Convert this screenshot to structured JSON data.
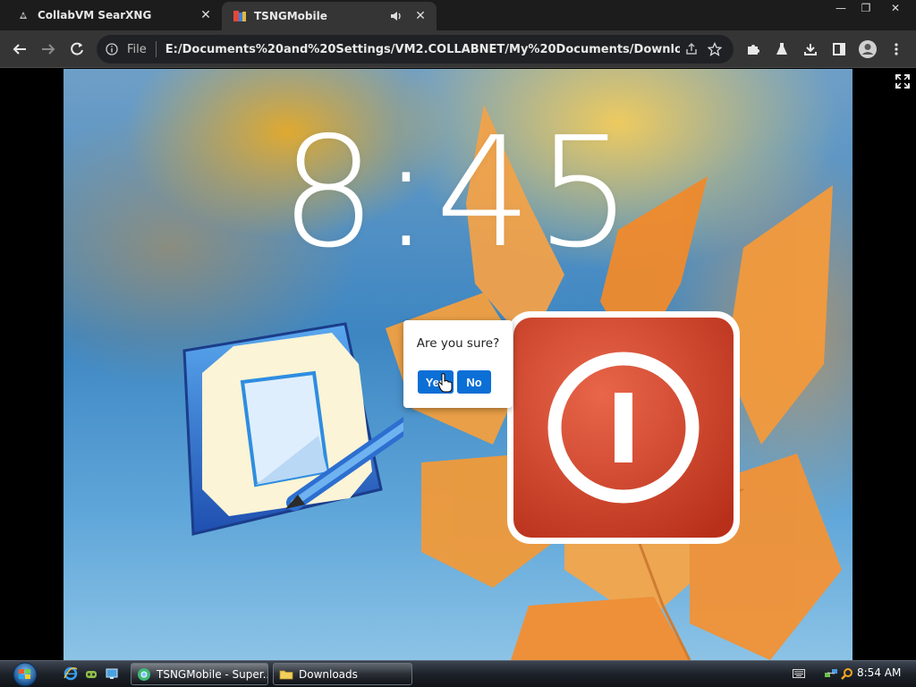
{
  "browser": {
    "tabs": [
      {
        "title": "CollabVM SearXNG",
        "icon": "searxng-icon",
        "close": "✕"
      },
      {
        "title": "TSNGMobile",
        "icon": "tsng-icon",
        "close": "✕",
        "audio_icon": "speaker-icon"
      }
    ],
    "window_controls": {
      "minimize": "—",
      "restore": "❐",
      "close": "✕"
    },
    "address": {
      "scheme": "File",
      "url": "E:/Documents%20and%20Settings/VM2.COLLABNET/My%20Documents/Downloads/TSNG..."
    },
    "toolbar_icons": [
      "back-icon",
      "forward-icon",
      "reload-icon",
      "share-icon",
      "bookmark-star-icon",
      "extensions-icon",
      "labs-icon",
      "download-icon",
      "side-panel-icon",
      "profile-icon",
      "menu-icon"
    ]
  },
  "page": {
    "clock": "8:45",
    "dialog": {
      "message": "Are you sure?",
      "yes_label": "Yes",
      "no_label": "No"
    },
    "apps": [
      "notes-app-icon",
      "power-app-icon"
    ]
  },
  "taskbar": {
    "buttons": [
      {
        "label": "TSNGMobile - Super...",
        "icon": "chrome-icon"
      },
      {
        "label": "Downloads",
        "icon": "folder-icon"
      }
    ],
    "time": "8:54 AM"
  },
  "colors": {
    "dialog_button": "#0b6fd6",
    "power_red": "#d9472b"
  }
}
